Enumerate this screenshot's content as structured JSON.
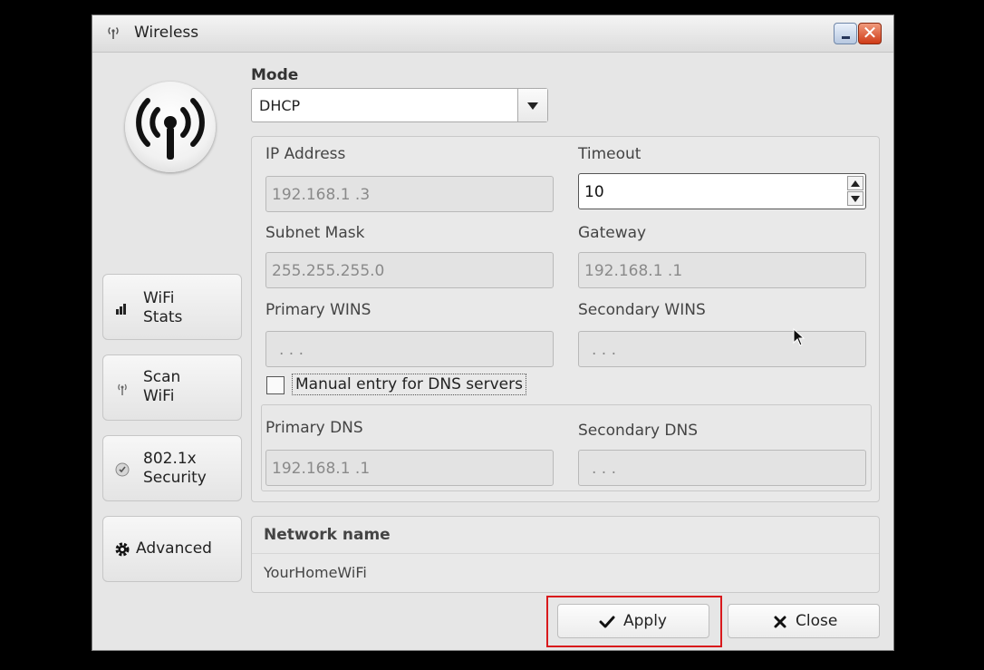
{
  "window": {
    "title": "Wireless",
    "icons": [
      "wireless-antenna-icon",
      "minimize-icon",
      "close-icon"
    ]
  },
  "sidebar": {
    "logo_icon": "wireless-signal-icon",
    "items": [
      {
        "line1": "WiFi",
        "line2": "Stats",
        "icon": "signal-bars-icon"
      },
      {
        "line1": "Scan",
        "line2": "WiFi",
        "icon": "antenna-icon"
      },
      {
        "line1": "802.1x",
        "line2": "Security",
        "icon": "security-icon"
      },
      {
        "label": "Advanced",
        "icon": "gear-icon"
      }
    ]
  },
  "mode": {
    "label": "Mode",
    "value": "DHCP"
  },
  "fields": {
    "ip_address": {
      "label": "IP Address",
      "value": "192.168.1  .3"
    },
    "timeout": {
      "label": "Timeout",
      "value": "10"
    },
    "subnet_mask": {
      "label": "Subnet Mask",
      "value": "255.255.255.0"
    },
    "gateway": {
      "label": "Gateway",
      "value": "192.168.1  .1"
    },
    "primary_wins": {
      "label": "Primary WINS",
      "value": "  .   .   ."
    },
    "secondary_wins": {
      "label": "Secondary WINS",
      "value": "  .   .   ."
    },
    "manual_dns": {
      "label": "Manual entry for DNS servers",
      "checked": false
    },
    "primary_dns": {
      "label": "Primary DNS",
      "value": "192.168.1  .1"
    },
    "secondary_dns": {
      "label": "Secondary DNS",
      "value": "  .   .   ."
    }
  },
  "network": {
    "header": "Network name",
    "value": "YourHomeWiFi"
  },
  "buttons": {
    "apply": {
      "label": "Apply",
      "icon": "checkmark-icon"
    },
    "close": {
      "label": "Close",
      "icon": "x-icon"
    }
  },
  "colors": {
    "highlight": "#d9191c",
    "background": "#000000",
    "window": "#e6e6e6"
  }
}
